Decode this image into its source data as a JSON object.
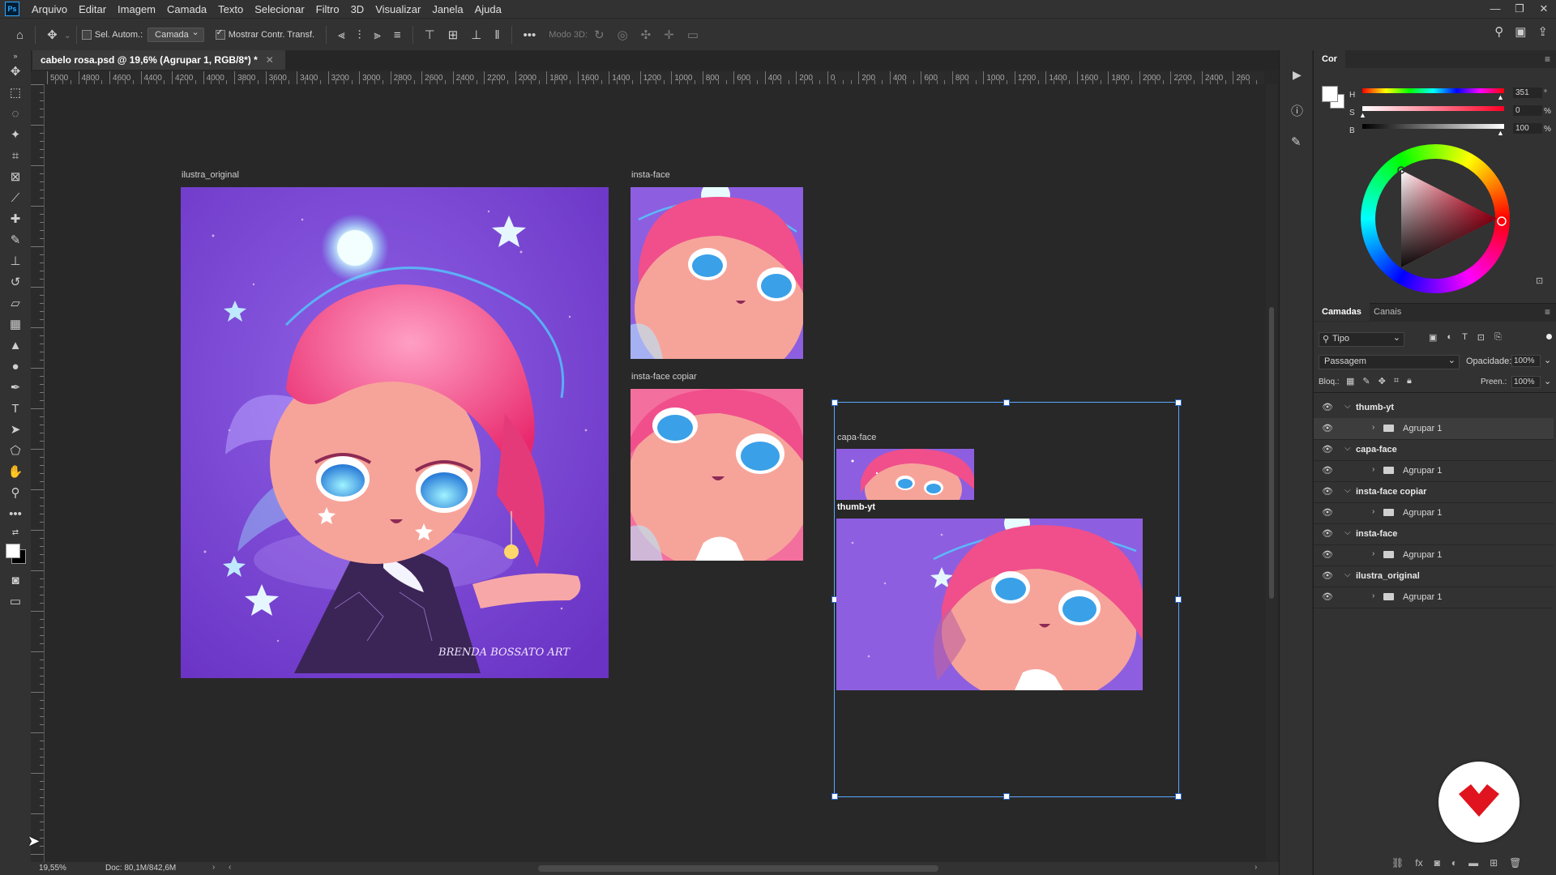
{
  "app": {
    "logo": "Ps"
  },
  "menu": [
    "Arquivo",
    "Editar",
    "Imagem",
    "Camada",
    "Texto",
    "Selecionar",
    "Filtro",
    "3D",
    "Visualizar",
    "Janela",
    "Ajuda"
  ],
  "options": {
    "auto_select_label": "Sel. Autom.:",
    "auto_select_target": "Camada",
    "show_transform_label": "Mostrar Contr. Transf.",
    "mode_3d_label": "Modo 3D:"
  },
  "document": {
    "tab_title": "cabelo rosa.psd @ 19,6% (Agrupar 1, RGB/8*) *"
  },
  "ruler_labels": [
    "5000",
    "4800",
    "4600",
    "4400",
    "4200",
    "4000",
    "3800",
    "3600",
    "3400",
    "3200",
    "3000",
    "2800",
    "2600",
    "2400",
    "2200",
    "2000",
    "1800",
    "1600",
    "1400",
    "1200",
    "1000",
    "800",
    "600",
    "400",
    "200",
    "0",
    "200",
    "400",
    "600",
    "800",
    "1000",
    "1200",
    "1400",
    "1600",
    "1800",
    "2000",
    "2200",
    "2400",
    "260"
  ],
  "artboards": {
    "ilustra_original": "ilustra_original",
    "insta_face": "insta-face",
    "insta_face_copiar": "insta-face copiar",
    "capa_face": "capa-face",
    "thumb_yt": "thumb-yt",
    "signature": "BRENDA BOSSATO ART"
  },
  "status": {
    "zoom": "19,55%",
    "doc_size": "Doc: 80,1M/842,6M"
  },
  "color_panel": {
    "tab": "Cor",
    "h_label": "H",
    "h_value": "351",
    "h_unit": "°",
    "s_label": "S",
    "s_value": "0",
    "s_unit": "%",
    "b_label": "B",
    "b_value": "100",
    "b_unit": "%"
  },
  "layers_panel": {
    "tabs": [
      "Camadas",
      "Canais"
    ],
    "filter_type": "Tipo",
    "blend_mode": "Passagem",
    "opacity_label": "Opacidade:",
    "opacity_value": "100%",
    "lock_label": "Bloq.:",
    "fill_label": "Preen.:",
    "fill_value": "100%",
    "layers": [
      {
        "name": "thumb-yt",
        "group": "Agrupar 1"
      },
      {
        "name": "capa-face",
        "group": "Agrupar 1"
      },
      {
        "name": "insta-face copiar",
        "group": "Agrupar 1"
      },
      {
        "name": "insta-face",
        "group": "Agrupar 1"
      },
      {
        "name": "ilustra_original",
        "group": "Agrupar 1"
      }
    ]
  }
}
